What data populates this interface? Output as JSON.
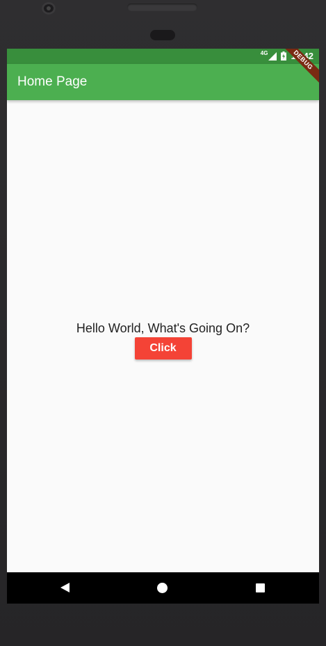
{
  "status_bar": {
    "network": "4G",
    "time": "11:42"
  },
  "app_bar": {
    "title": "Home Page",
    "debug_banner": "DEBUG"
  },
  "main": {
    "message": "Hello World, What's Going On?",
    "button_label": "Click"
  },
  "colors": {
    "status_bar": "#388e3c",
    "app_bar": "#4caf50",
    "button": "#f44336",
    "background": "#fafafa"
  },
  "icons": {
    "signal": "signal-icon",
    "battery": "battery-icon",
    "back": "back-icon",
    "home": "home-icon",
    "recents": "recents-icon"
  }
}
